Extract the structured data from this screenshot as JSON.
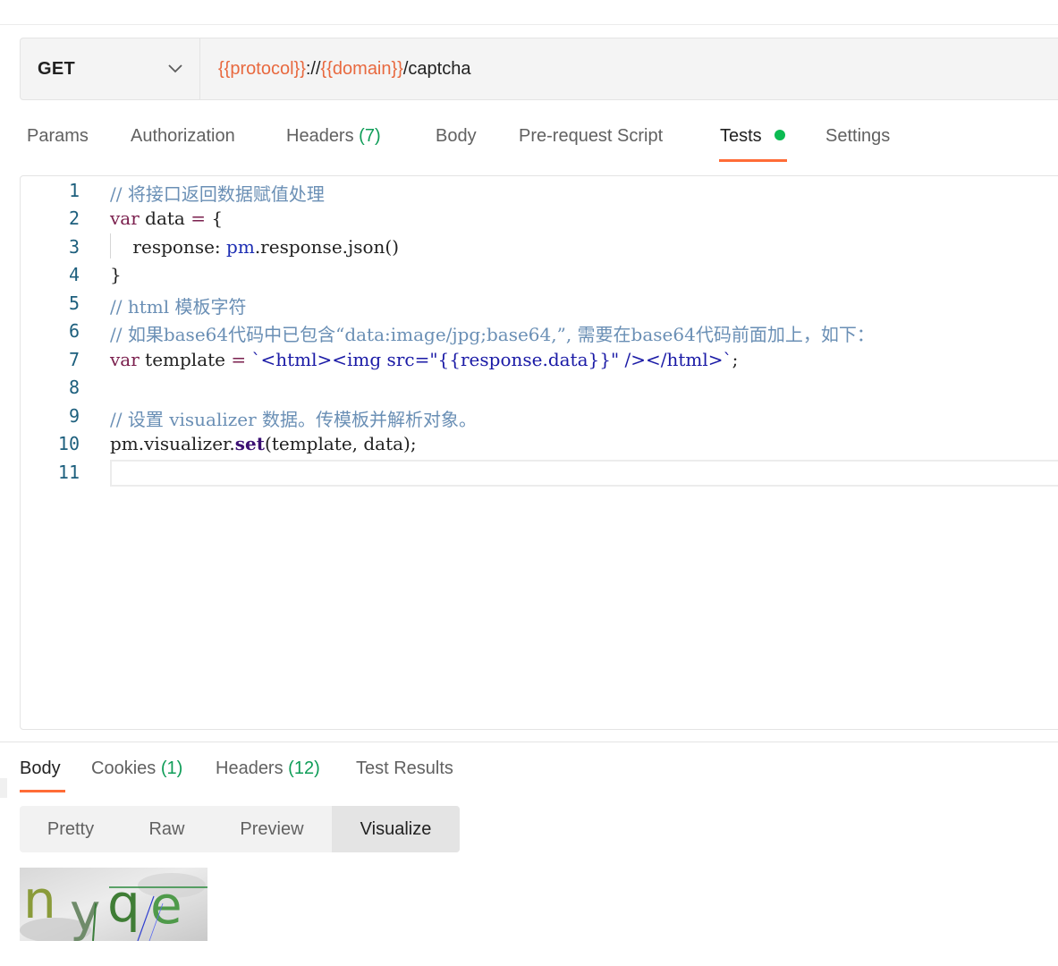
{
  "request": {
    "method": "GET",
    "url": {
      "protocol_var": "{{protocol}}",
      "separator": "://",
      "domain_var": "{{domain}}",
      "path": "/captcha"
    }
  },
  "request_tabs": [
    {
      "label": "Params"
    },
    {
      "label": "Authorization"
    },
    {
      "label": "Headers",
      "count": "(7)"
    },
    {
      "label": "Body"
    },
    {
      "label": "Pre-request Script"
    },
    {
      "label": "Tests",
      "active": true
    },
    {
      "label": "Settings"
    }
  ],
  "editor": {
    "line_numbers": [
      "1",
      "2",
      "3",
      "4",
      "5",
      "6",
      "7",
      "8",
      "9",
      "10",
      "11"
    ],
    "lines": {
      "l1": "// 将接口返回数据赋值处理",
      "l2_kw": "var",
      "l2_name": " data ",
      "l2_op": "=",
      "l2_rest": " {",
      "l3_prop": "    response",
      "l3_colon": ": ",
      "l3_obj": "pm",
      "l3_mid": ".response.json()",
      "l4": "}",
      "l5": "// html 模板字符",
      "l6": "// 如果base64代码中已包含“data:image/jpg;base64,”, 需要在base64代码前面加上，如下：",
      "l7_kw": "var",
      "l7_name": " template ",
      "l7_op": "=",
      "l7_str": " `<html><img src=\"{{response.data}}\" /></html>`",
      "l7_end": ";",
      "l9": "// 设置 visualizer 数据。传模板并解析对象。",
      "l10_a": "pm.visualizer.",
      "l10_fn": "set",
      "l10_b": "(template, data);"
    }
  },
  "response_tabs": [
    {
      "label": "Body",
      "active": true
    },
    {
      "label": "Cookies",
      "count": "(1)"
    },
    {
      "label": "Headers",
      "count": "(12)"
    },
    {
      "label": "Test Results"
    }
  ],
  "view_modes": [
    "Pretty",
    "Raw",
    "Preview",
    "Visualize"
  ],
  "active_view_mode": "Visualize",
  "captcha": {
    "text": "nyqe"
  },
  "colors": {
    "accent": "#ff6c37",
    "variable": "#e8693f",
    "count": "#0f9d58",
    "status_dot": "#0cbb52"
  }
}
